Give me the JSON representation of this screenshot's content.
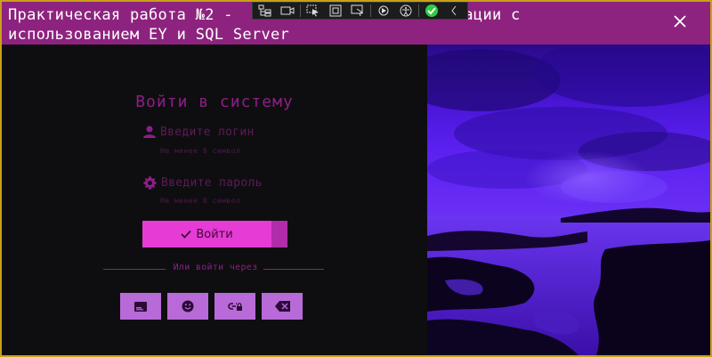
{
  "window": {
    "title_line1": "Практическая работа №2 -",
    "title_line1_right": "зации с",
    "title_line2": "использованием EY и SQL Server",
    "close_glyph": "✕"
  },
  "devtools_toolbar": {
    "icons": [
      "live-visual-tree-icon",
      "record-icon",
      "select-element-icon",
      "layout-adorner-icon",
      "track-focus-icon",
      "hot-reload-icon",
      "accessibility-icon",
      "check-status-icon",
      "collapse-chevron-icon"
    ]
  },
  "login": {
    "heading": "Войти в систему",
    "login_label": "Введите логин",
    "login_hint": "Не менее 8 символ",
    "password_label": "Введите пароль",
    "password_hint": "Не менее 8 символ",
    "login_button_label": "Войти",
    "divider_text": "Или войти через",
    "social_icons": [
      "card-icon",
      "smile-icon",
      "link-lock-icon",
      "backspace-icon"
    ]
  },
  "colors": {
    "titlebar": "#8d237f",
    "accent": "#e73bd6",
    "heading": "#8e1e86",
    "social_button": "#b86ad8",
    "background": "#0e0e10"
  }
}
